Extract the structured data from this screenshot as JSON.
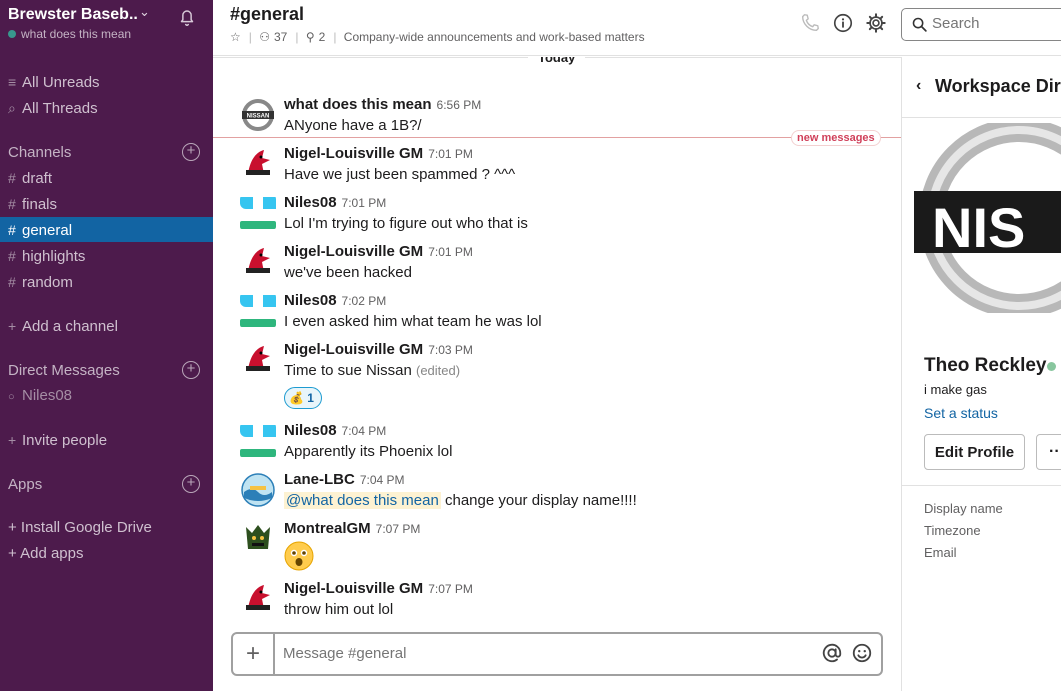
{
  "workspace": {
    "name": "Brewster Baseb...",
    "user_status": "what does this mean"
  },
  "sidebar": {
    "all_unreads": "All Unreads",
    "all_threads": "All Threads",
    "channels_heading": "Channels",
    "channels": [
      {
        "name": "draft"
      },
      {
        "name": "finals"
      },
      {
        "name": "general",
        "active": true
      },
      {
        "name": "highlights"
      },
      {
        "name": "random"
      }
    ],
    "add_channel": "Add a channel",
    "dm_heading": "Direct Messages",
    "dms": [
      {
        "name": "Niles08"
      }
    ],
    "invite_people": "Invite people",
    "apps_heading": "Apps",
    "install_drive": "+ Install Google Drive",
    "add_apps": "+ Add apps"
  },
  "header": {
    "channel_title": "#general",
    "member_count": "37",
    "pinned_count": "2",
    "topic": "Company-wide announcements and work-based matters",
    "search_placeholder": "Search"
  },
  "messages": {
    "date_label": "Today",
    "new_messages_label": "new messages",
    "items": [
      {
        "author": "what does this mean",
        "time": "6:56 PM",
        "text": "ANyone have a 1B?/",
        "avatar": "nissan-logo"
      },
      {
        "author": "Nigel-Louisville GM",
        "time": "7:01 PM",
        "text": "Have we just been spammed ? ^^^",
        "avatar": "cardinal-logo"
      },
      {
        "author": "Niles08",
        "time": "7:01 PM",
        "text": "Lol I'm trying to figure out who that is",
        "avatar": "default-avatar"
      },
      {
        "author": "Nigel-Louisville GM",
        "time": "7:01 PM",
        "text": "we've been hacked",
        "avatar": "cardinal-logo"
      },
      {
        "author": "Niles08",
        "time": "7:02 PM",
        "text": "I even asked him what team he was lol",
        "avatar": "default-avatar"
      },
      {
        "author": "Nigel-Louisville GM",
        "time": "7:03 PM",
        "text": "Time  to sue Nissan",
        "edited": "(edited)",
        "avatar": "cardinal-logo",
        "reaction": {
          "emoji": "money-bag",
          "glyph": "💰",
          "count": "1"
        }
      },
      {
        "author": "Niles08",
        "time": "7:04 PM",
        "text": "Apparently its Phoenix lol",
        "avatar": "default-avatar"
      },
      {
        "author": "Lane-LBC",
        "time": "7:04 PM",
        "mention": "@what does this mean",
        "text": " change your display name!!!!",
        "avatar": "lbc-logo"
      },
      {
        "author": "MontrealGM",
        "time": "7:07 PM",
        "text": "",
        "emoji": "astonished-face",
        "avatar": "montreal-logo"
      },
      {
        "author": "Nigel-Louisville GM",
        "time": "7:07 PM",
        "text": "throw him out lol",
        "avatar": "cardinal-logo"
      }
    ]
  },
  "composer": {
    "placeholder": "Message #general"
  },
  "panel": {
    "title": "Workspace Directory",
    "profile_name": "Theo Reckley",
    "profile_title": "i make gas",
    "set_status": "Set a status",
    "edit_profile": "Edit Profile",
    "more": "··",
    "fields": [
      "Display name",
      "Timezone",
      "Email"
    ]
  },
  "colors": {
    "sidebar_bg": "#4d1b4c",
    "active_channel": "#1264a3",
    "new_messages": "#d0405a",
    "link": "#1264a3"
  }
}
